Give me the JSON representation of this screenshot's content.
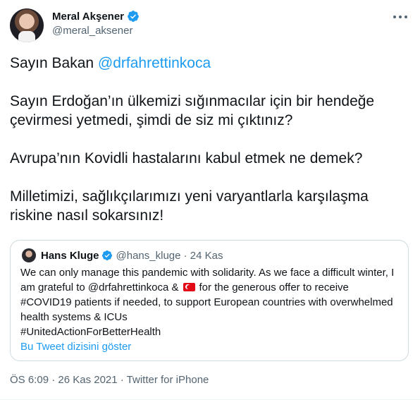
{
  "author": {
    "display_name": "Meral Akşener",
    "handle": "@meral_aksener"
  },
  "tweet": {
    "p1_prefix": "Sayın Bakan ",
    "p1_mention": "@drfahrettinkoca",
    "p2": "Sayın Erdoğan’ın ülkemizi sığınmacılar için bir hendeğe çevirmesi yetmedi, şimdi de siz mi çıktınız?",
    "p3": "Avrupa’nın Kovidli hastalarını kabul etmek ne demek?",
    "p4": "Milletimizi, sağlıkçılarımızı yeni varyantlarla karşılaşma riskine nasıl sokarsınız!"
  },
  "quote": {
    "display_name": "Hans Kluge",
    "handle_date": "@hans_kluge · 24 Kas",
    "body_part1": "We can only manage this pandemic with solidarity. As we face a difficult winter, I am grateful to @drfahrettinkoca &",
    "flag_icon": "turkey-flag-icon",
    "body_part2": "for the generous offer to receive #COVID19 patients if needed, to support European countries with overwhelmed health systems & ICUs",
    "hashtag_line": "#UnitedActionForBetterHealth",
    "show_thread": "Bu Tweet dizisini göster"
  },
  "meta": {
    "timestamp_source": "ÖS 6:09 · 26 Kas 2021 · Twitter for iPhone"
  },
  "colors": {
    "link": "#1d9bf0",
    "secondary_text": "#536471",
    "border": "#cfd9de"
  }
}
